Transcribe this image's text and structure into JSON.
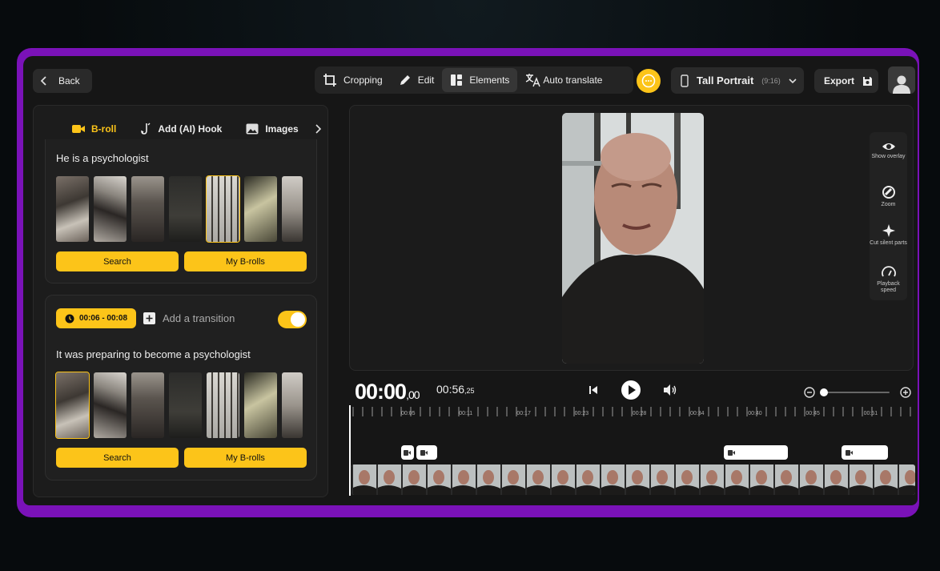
{
  "toolbar": {
    "back_label": "Back",
    "cropping_label": "Cropping",
    "edit_label": "Edit",
    "elements_label": "Elements",
    "auto_translate_label": "Auto translate",
    "portrait_label": "Tall Portrait",
    "portrait_ratio": "(9:16)",
    "export_label": "Export"
  },
  "tabs": [
    {
      "label": "B-roll",
      "active": true
    },
    {
      "label": "Add (AI) Hook"
    },
    {
      "label": "Images"
    }
  ],
  "segments": [
    {
      "caption": "He is a psychologist",
      "search_label": "Search",
      "my_brolls_label": "My B-rolls"
    },
    {
      "time_range": "00:06 - 00:08",
      "add_transition_label": "Add a transition",
      "toggle_on": true,
      "caption": "It was preparing to become a psychologist",
      "search_label": "Search",
      "my_brolls_label": "My B-rolls"
    }
  ],
  "side_tools": [
    {
      "label": "Show overlay",
      "icon": "eye-icon"
    },
    {
      "label": "Zoom",
      "icon": "zoom-icon"
    },
    {
      "label": "Cut silent parts",
      "icon": "sparkle-icon"
    },
    {
      "label": "Playback speed",
      "icon": "speedometer-icon"
    }
  ],
  "player": {
    "current_time": "00:00",
    "current_frac": ",00",
    "duration": "00:56",
    "duration_frac": ",25",
    "zoom_level": 0.0
  },
  "ruler_labels": [
    "00:05",
    "00:11",
    "00:17",
    "00:23",
    "00:28",
    "00:34",
    "00:40",
    "00:45",
    "00:51"
  ],
  "accent_color": "#fcc419",
  "frame_color": "#7a12b8"
}
